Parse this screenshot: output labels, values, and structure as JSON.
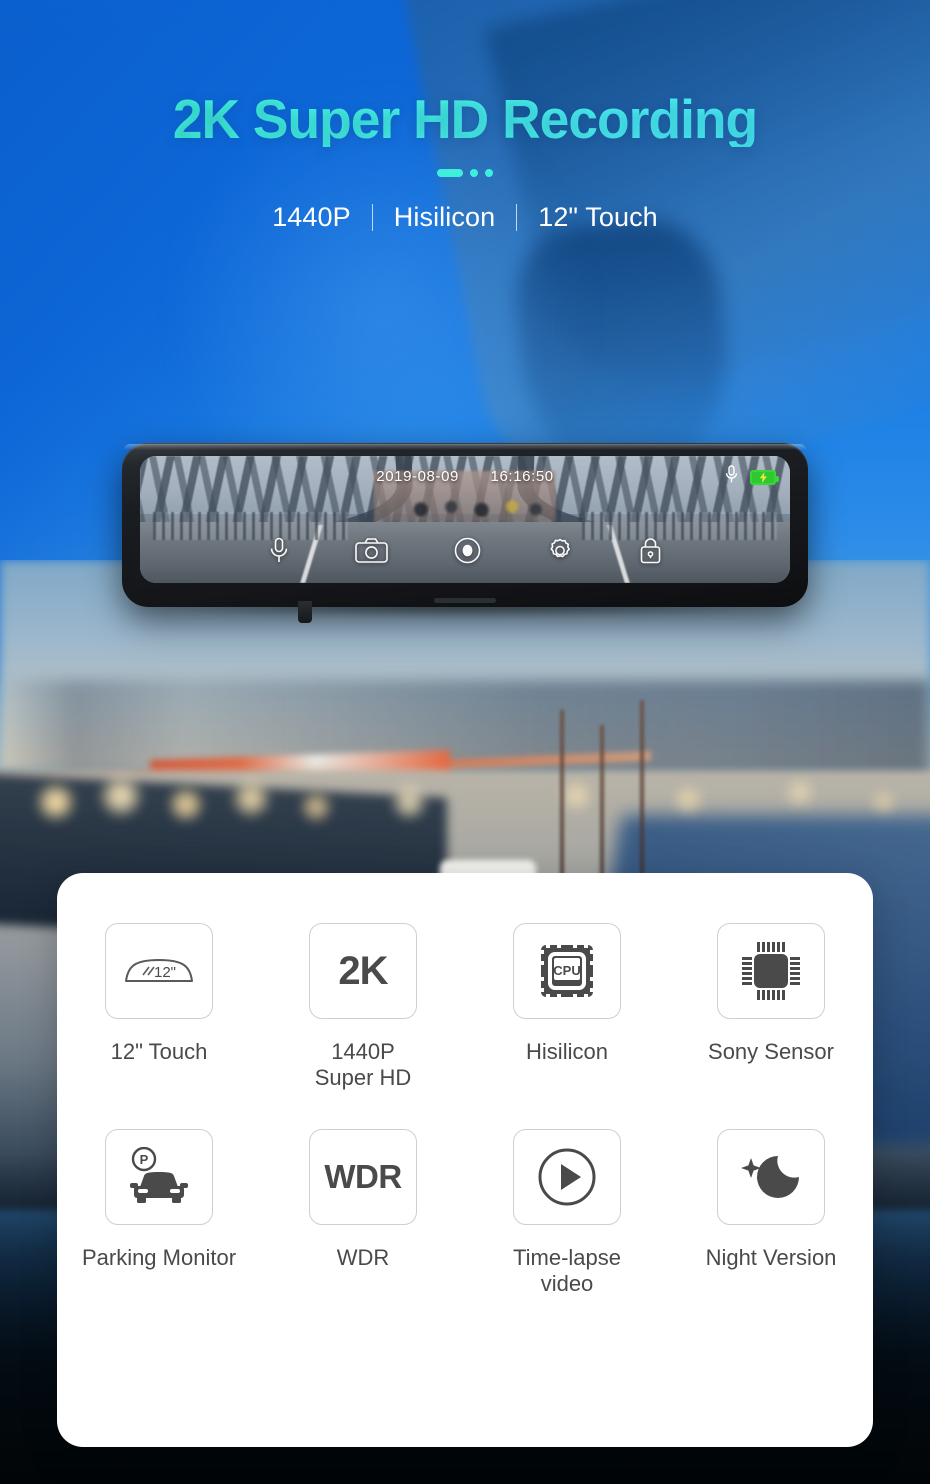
{
  "header": {
    "headline": "2K Super HD Recording",
    "specs": [
      "1440P",
      "Hisilicon",
      "12\" Touch"
    ]
  },
  "device": {
    "osd": {
      "date": "2019-08-09",
      "time": "16:16:50",
      "mic_icon": "microphone-icon",
      "battery_icon": "battery-charging-icon"
    },
    "controls": [
      {
        "name": "microphone-icon",
        "label": "Microphone"
      },
      {
        "name": "camera-icon",
        "label": "Photo"
      },
      {
        "name": "record-icon",
        "label": "Record"
      },
      {
        "name": "settings-gear-icon",
        "label": "Settings"
      },
      {
        "name": "lock-icon",
        "label": "Lock"
      }
    ]
  },
  "features": [
    {
      "icon": "mirror-screen-icon",
      "tile_text": "12\"",
      "label": "12\" Touch"
    },
    {
      "icon": "resolution-2k-icon",
      "tile_text": "2K",
      "label": "1440P\nSuper HD"
    },
    {
      "icon": "cpu-chip-icon",
      "tile_text": "CPU",
      "label": "Hisilicon"
    },
    {
      "icon": "sensor-chip-icon",
      "tile_text": "",
      "label": "Sony Sensor"
    },
    {
      "icon": "parking-car-icon",
      "tile_text": "P",
      "label": "Parking Monitor"
    },
    {
      "icon": "wdr-icon",
      "tile_text": "WDR",
      "label": "WDR"
    },
    {
      "icon": "play-circle-icon",
      "tile_text": "",
      "label": "Time-lapse\nvideo"
    },
    {
      "icon": "moon-stars-icon",
      "tile_text": "",
      "label": "Night Version"
    }
  ],
  "feature_labels": {
    "f0": "12\" Touch",
    "f1_line1": "1440P",
    "f1_line2": "Super HD",
    "f2": "Hisilicon",
    "f3": "Sony Sensor",
    "f4": "Parking Monitor",
    "f5": "WDR",
    "f6_line1": "Time-lapse",
    "f6_line2": "video",
    "f7": "Night Version"
  },
  "tile_texts": {
    "t0": "12\"",
    "t1": "2K",
    "t2": "CPU",
    "t5": "WDR"
  },
  "colors": {
    "headline_cyan": "#40f2dc",
    "bg_blue": "#0f6bd8",
    "card_white": "#ffffff",
    "label_gray": "#4a4a4a",
    "battery_green": "#37d63a"
  }
}
